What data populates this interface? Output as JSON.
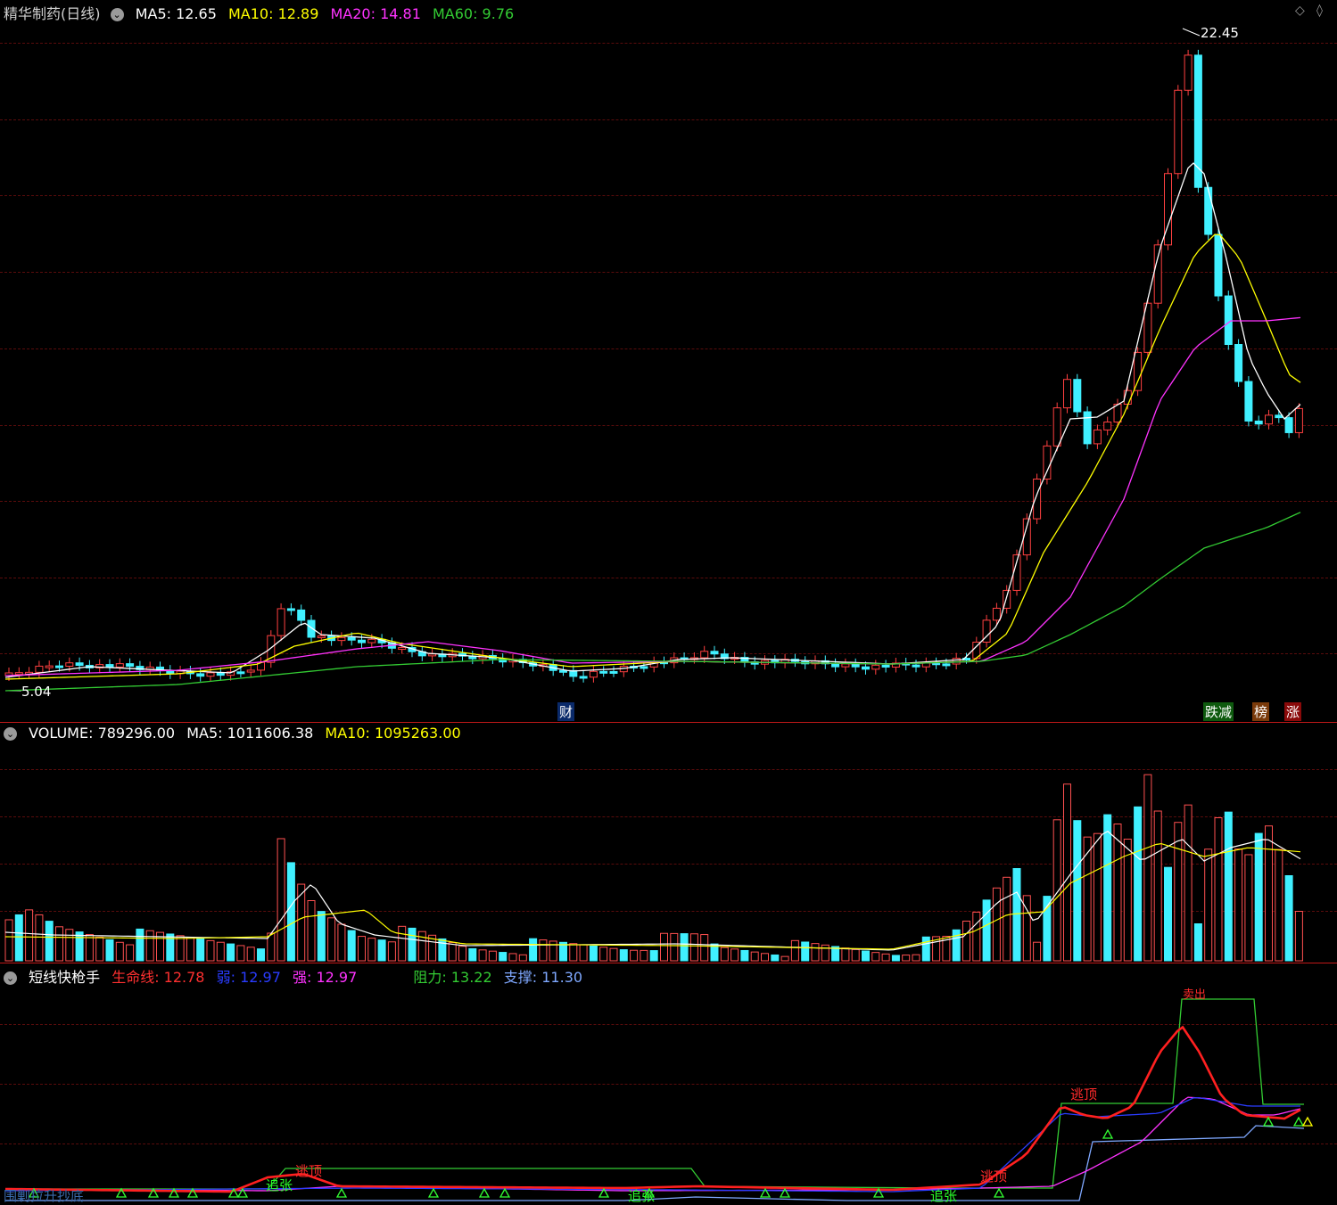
{
  "main": {
    "title": "精华制药(日线)",
    "ma_items": [
      {
        "label": "MA5: 12.65",
        "color": "#ffffff"
      },
      {
        "label": "MA10: 12.89",
        "color": "#ffff00"
      },
      {
        "label": "MA20: 14.81",
        "color": "#ff33ff"
      },
      {
        "label": "MA60: 9.76",
        "color": "#33cc33"
      }
    ],
    "high_label": "22.45",
    "low_label": "5.04",
    "badges": {
      "cai": "财",
      "diejian": "跌减",
      "bang": "榜",
      "zhang": "涨"
    }
  },
  "volume": {
    "label": "VOLUME: 789296.00",
    "ma5": "MA5: 1011606.38",
    "ma10": "MA10: 1095263.00"
  },
  "indicator": {
    "name": "短线快枪手",
    "items": [
      {
        "label": "生命线: 12.78",
        "color": "#ff3030"
      },
      {
        "label": "弱: 12.97",
        "color": "#2a3cff"
      },
      {
        "label": "强: 12.97",
        "color": "#ff33ff"
      },
      {
        "label": "阻力: 13.22",
        "color": "#33cc33"
      },
      {
        "label": "支撑: 11.30",
        "color": "#7fa8ff"
      }
    ],
    "signals": {
      "zhuizhang": "追张",
      "taoding": "逃顶",
      "zhuizhang2": "追张",
      "zhuizhang3": "追张",
      "taoding2": "逃顶",
      "taoding3": "逃顶",
      "maichu": "卖出",
      "left_label": "围剿拉升抄底"
    }
  },
  "chart_data": {
    "type": "candlestick",
    "title": "精华制药(日线)",
    "price_max_label": 22.45,
    "price_min_label": 5.04,
    "ma": {
      "MA5": 12.65,
      "MA10": 12.89,
      "MA20": 14.81,
      "MA60": 9.76
    },
    "volume": {
      "VOLUME": 789296.0,
      "MA5": 1011606.38,
      "MA10": 1095263.0
    },
    "indicator": {
      "name": "短线快枪手",
      "生命线": 12.78,
      "弱": 12.97,
      "强": 12.97,
      "阻力": 13.22,
      "支撑": 11.3
    }
  }
}
